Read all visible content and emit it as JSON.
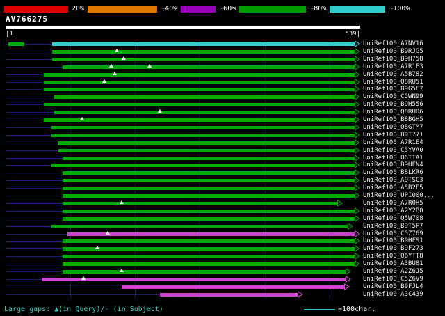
{
  "header": {
    "key": [
      {
        "label": "20%",
        "color": "#DD0000"
      },
      {
        "label": "~40%",
        "color": "#DD7700"
      },
      {
        "label": "~60%",
        "color": "#9900BB"
      },
      {
        "label": "~80%",
        "color": "#009900"
      },
      {
        "label": "~100%",
        "color": "#33CCCC"
      }
    ],
    "query_name": "AV766275",
    "ruler_start": "|1",
    "ruler_end": "539|"
  },
  "footer": {
    "gaps_note": "Large gaps: ▲(in Query)/- (in Subject)",
    "scale_label": "=100char."
  },
  "chart_data": {
    "type": "alignment-hit-map",
    "title": "AV766275",
    "query_length": 539,
    "row_height": 10.9,
    "gridlines": [
      100,
      200,
      300,
      400,
      500
    ],
    "colors": {
      "green": "#00AA00",
      "cyan": "#35CCCC",
      "magenta": "#CC44CC"
    },
    "rows": [
      {
        "label": "UniRef100_A7NV16",
        "color": "cyan",
        "start": 72,
        "end": 539,
        "markers": [],
        "pre": [
          4,
          29
        ]
      },
      {
        "label": "UniRef100_B9RJG5",
        "color": "green",
        "start": 72,
        "end": 539,
        "markers": [
          172
        ]
      },
      {
        "label": "UniRef100_B9H758",
        "color": "green",
        "start": 72,
        "end": 539,
        "markers": [
          183
        ]
      },
      {
        "label": "UniRef100_A7R1E3",
        "color": "green",
        "start": 88,
        "end": 539,
        "markers": [
          163,
          222
        ]
      },
      {
        "label": "UniRef100_A5B782",
        "color": "green",
        "start": 59,
        "end": 539,
        "markers": [
          169
        ]
      },
      {
        "label": "UniRef100_Q8RU51",
        "color": "green",
        "start": 59,
        "end": 539,
        "markers": [
          152
        ]
      },
      {
        "label": "UniRef100_B9G5E7",
        "color": "green",
        "start": 59,
        "end": 539,
        "markers": []
      },
      {
        "label": "UniRef100_C5WN99",
        "color": "green",
        "start": 75,
        "end": 539,
        "markers": []
      },
      {
        "label": "UniRef100_B9H556",
        "color": "green",
        "start": 59,
        "end": 539,
        "markers": []
      },
      {
        "label": "UniRef100_Q8RU06",
        "color": "green",
        "start": 75,
        "end": 539,
        "markers": [
          238
        ]
      },
      {
        "label": "UniRef100_B8BGH5",
        "color": "green",
        "start": 59,
        "end": 539,
        "markers": [
          118
        ]
      },
      {
        "label": "UniRef100_Q8GTM7",
        "color": "green",
        "start": 71,
        "end": 539,
        "markers": []
      },
      {
        "label": "UniRef100_B9T771",
        "color": "green",
        "start": 71,
        "end": 539,
        "markers": []
      },
      {
        "label": "UniRef100_A7R1E4",
        "color": "green",
        "start": 82,
        "end": 539,
        "markers": []
      },
      {
        "label": "UniRef100_C5YVA0",
        "color": "green",
        "start": 82,
        "end": 539,
        "markers": []
      },
      {
        "label": "UniRef100_B6TTA1",
        "color": "green",
        "start": 88,
        "end": 539,
        "markers": []
      },
      {
        "label": "UniRef100_B9HFN4",
        "color": "green",
        "start": 71,
        "end": 539,
        "markers": []
      },
      {
        "label": "UniRef100_B8LKR6",
        "color": "green",
        "start": 88,
        "end": 539,
        "markers": []
      },
      {
        "label": "UniRef100_A9TSC3",
        "color": "green",
        "start": 88,
        "end": 539,
        "markers": []
      },
      {
        "label": "UniRef100_A5B2F5",
        "color": "green",
        "start": 88,
        "end": 539,
        "markers": []
      },
      {
        "label": "UniRef100_UPI000...",
        "color": "green",
        "start": 88,
        "end": 539,
        "markers": []
      },
      {
        "label": "UniRef100_A7R0H5",
        "color": "green",
        "start": 88,
        "end": 512,
        "markers": [
          179
        ]
      },
      {
        "label": "UniRef100_A2Y2B0",
        "color": "green",
        "start": 88,
        "end": 539,
        "markers": []
      },
      {
        "label": "UniRef100_Q5W708",
        "color": "green",
        "start": 88,
        "end": 539,
        "markers": []
      },
      {
        "label": "UniRef100_B9T5P7",
        "color": "green",
        "start": 71,
        "end": 528,
        "markers": []
      },
      {
        "label": "UniRef100_C5Z769",
        "color": "magenta",
        "start": 96,
        "end": 539,
        "markers": [
          158
        ]
      },
      {
        "label": "UniRef100_B9HFS1",
        "color": "green",
        "start": 88,
        "end": 539,
        "markers": []
      },
      {
        "label": "UniRef100_B9F273",
        "color": "green",
        "start": 88,
        "end": 539,
        "markers": [
          142
        ]
      },
      {
        "label": "UniRef100_Q6YTT8",
        "color": "green",
        "start": 88,
        "end": 539,
        "markers": []
      },
      {
        "label": "UniRef100_A3BU81",
        "color": "green",
        "start": 88,
        "end": 539,
        "markers": []
      },
      {
        "label": "UniRef100_A2Z6J5",
        "color": "green",
        "start": 88,
        "end": 525,
        "markers": [
          179
        ]
      },
      {
        "label": "UniRef100_C5Z6V9",
        "color": "magenta",
        "start": 56,
        "end": 525,
        "markers": [
          120
        ]
      },
      {
        "label": "UniRef100_B9FJL4",
        "color": "magenta",
        "start": 179,
        "end": 523,
        "markers": []
      },
      {
        "label": "UniRef100_A3C439",
        "color": "magenta",
        "start": 238,
        "end": 451,
        "markers": []
      }
    ]
  }
}
